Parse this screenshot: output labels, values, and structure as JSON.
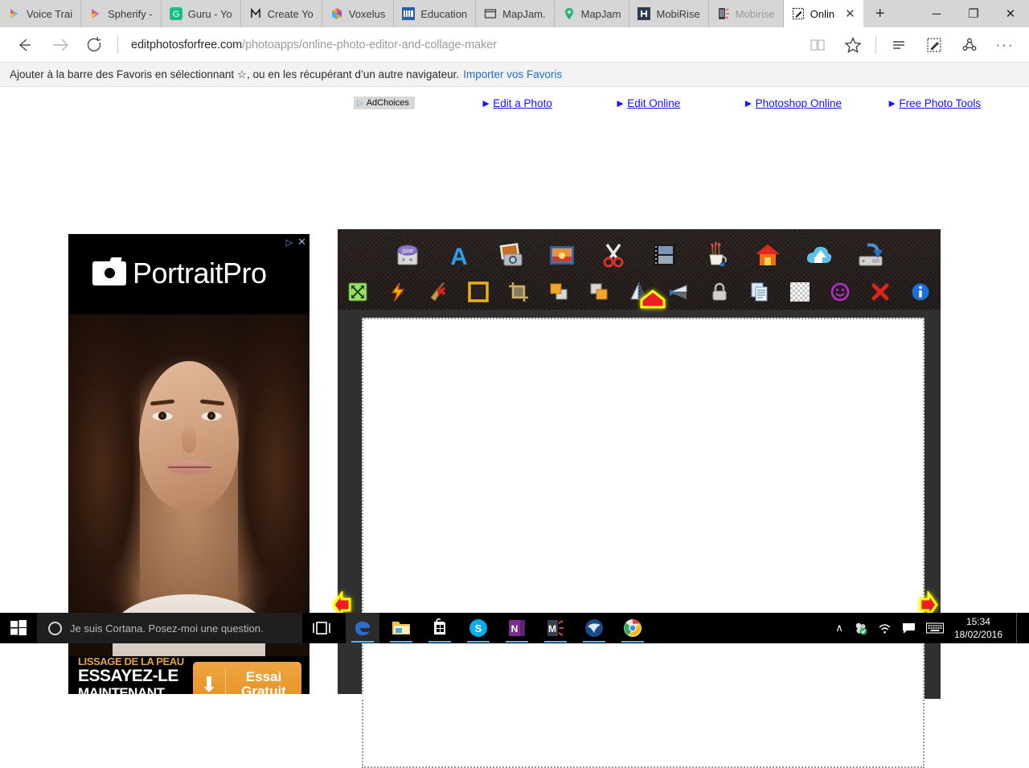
{
  "browser": {
    "tabs": [
      {
        "label": "Voice Trai",
        "icon": "play-store-icon",
        "active": false,
        "dim": false
      },
      {
        "label": "Spherify -",
        "icon": "play-store-icon",
        "active": false,
        "dim": false
      },
      {
        "label": "Guru - Yo",
        "icon": "guru-g-icon",
        "active": false,
        "dim": false
      },
      {
        "label": "Create Yo",
        "icon": "m-letter-icon",
        "active": false,
        "dim": false
      },
      {
        "label": "Voxelus",
        "icon": "voxelus-icon",
        "active": false,
        "dim": false
      },
      {
        "label": "Education",
        "icon": "education-icon",
        "active": false,
        "dim": false
      },
      {
        "label": "MapJam.",
        "icon": "window-icon",
        "active": false,
        "dim": false
      },
      {
        "label": "MapJam",
        "icon": "map-pin-icon",
        "active": false,
        "dim": false
      },
      {
        "label": "MobiRise",
        "icon": "mobirise-icon",
        "active": false,
        "dim": false
      },
      {
        "label": "Mobirise",
        "icon": "mobirise-phone-icon",
        "active": false,
        "dim": true
      },
      {
        "label": "Onlin",
        "icon": "pencil-box-icon",
        "active": true,
        "dim": false
      }
    ],
    "tab_close_label": "✕",
    "new_tab_label": "+",
    "window_controls": {
      "minimize": "─",
      "restore": "❐",
      "close": "✕"
    },
    "nav": {
      "back": "←",
      "forward": "→",
      "refresh": "↻",
      "reading_view": "reading-view-icon",
      "favorite": "☆",
      "hub": "hub-icon",
      "web_note": "web-note-icon",
      "share": "share-icon",
      "more": "···"
    },
    "url": {
      "domain": "editphotosforfree.com",
      "path": "/photoapps/online-photo-editor-and-collage-maker"
    },
    "favorites_bar": {
      "message": "Ajouter à la barre des Favoris en sélectionnant ☆, ou en les récupérant d’un autre navigateur.",
      "link": "Importer vos Favoris"
    }
  },
  "ad_links": {
    "adchoices": "AdChoices",
    "items": [
      {
        "arrow": "►",
        "label": "Edit a Photo"
      },
      {
        "arrow": "►",
        "label": "Edit Online"
      },
      {
        "arrow": "►",
        "label": "Photoshop Online"
      },
      {
        "arrow": "►",
        "label": "Free Photo Tools"
      }
    ]
  },
  "advertisement": {
    "brand": "PortraitPro",
    "adchoices_icon": "▷",
    "close_icon": "✕",
    "headline_small": "LISSAGE DE LA PEAU",
    "headline_large": "ESSAYEZ-LE",
    "headline_third": "MAINTENANT",
    "button_line1": "Essai",
    "button_line2": "Gratuit",
    "download_icon": "⬇"
  },
  "editor": {
    "toolbar_row1": [
      {
        "name": "json-open-icon",
        "title": "Open project"
      },
      {
        "name": "text-tool-icon",
        "title": "Add text"
      },
      {
        "name": "photos-camera-icon",
        "title": "Add photo"
      },
      {
        "name": "image-sunset-icon",
        "title": "Background image"
      },
      {
        "name": "scissors-cut-icon",
        "title": "Cut"
      },
      {
        "name": "filmstrip-icon",
        "title": "Collage"
      },
      {
        "name": "brush-cup-icon",
        "title": "Paint tools"
      },
      {
        "name": "home-house-icon",
        "title": "Home"
      },
      {
        "name": "cloud-upload-icon",
        "title": "Upload"
      },
      {
        "name": "save-disk-icon",
        "title": "Save"
      }
    ],
    "toolbar_row2": [
      {
        "name": "resize-arrows-icon",
        "title": "Resize"
      },
      {
        "name": "lightning-bolt-icon",
        "title": "Auto enhance"
      },
      {
        "name": "broom-clear-icon",
        "title": "Clear"
      },
      {
        "name": "frame-border-icon",
        "title": "Frame"
      },
      {
        "name": "crop-tool-icon",
        "title": "Crop"
      },
      {
        "name": "send-backward-icon",
        "title": "Send backward"
      },
      {
        "name": "bring-forward-icon",
        "title": "Bring forward"
      },
      {
        "name": "flip-vertical-icon",
        "title": "Flip vertical"
      },
      {
        "name": "flip-horizontal-icon",
        "title": "Flip horizontal"
      },
      {
        "name": "lock-icon",
        "title": "Lock"
      },
      {
        "name": "duplicate-pages-icon",
        "title": "Duplicate"
      },
      {
        "name": "transparency-grid-icon",
        "title": "Transparency"
      },
      {
        "name": "smiley-sticker-icon",
        "title": "Stickers"
      },
      {
        "name": "delete-x-icon",
        "title": "Delete"
      },
      {
        "name": "info-icon",
        "title": "Info"
      }
    ],
    "markers": {
      "top": "top-handle",
      "left": "left-handle",
      "right": "right-handle"
    }
  },
  "taskbar": {
    "start": "start-icon",
    "cortana_placeholder": "Je suis Cortana. Posez-moi une question.",
    "task_view": "task-view-icon",
    "apps": [
      {
        "name": "edge-icon",
        "label": "e",
        "running": true,
        "active": true
      },
      {
        "name": "file-explorer-icon",
        "label": "",
        "running": true,
        "active": false
      },
      {
        "name": "store-icon",
        "label": "",
        "running": true,
        "active": false
      },
      {
        "name": "skype-icon",
        "label": "S",
        "running": true,
        "active": false
      },
      {
        "name": "onenote-icon",
        "label": "N",
        "running": true,
        "active": false
      },
      {
        "name": "mobirise-icon",
        "label": "M",
        "running": true,
        "active": false
      },
      {
        "name": "thunderbird-icon",
        "label": "",
        "running": true,
        "active": false
      },
      {
        "name": "chrome-icon",
        "label": "",
        "running": true,
        "active": false
      }
    ],
    "tray": {
      "chevron": "∧",
      "sync_icon": "sync-icon",
      "wifi_icon": "wifi-icon",
      "action_center_icon": "action-center-icon",
      "keyboard_icon": "keyboard-icon"
    },
    "time": "15:34",
    "date": "18/02/2016"
  }
}
